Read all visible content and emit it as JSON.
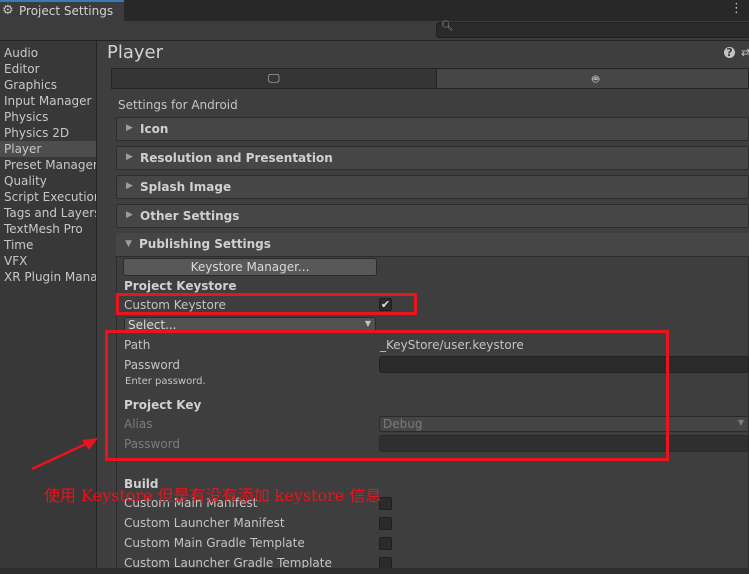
{
  "window": {
    "title": "Project Settings"
  },
  "sidebar": {
    "items": [
      {
        "label": "Audio",
        "selected": false
      },
      {
        "label": "Editor",
        "selected": false
      },
      {
        "label": "Graphics",
        "selected": false
      },
      {
        "label": "Input Manager",
        "selected": false
      },
      {
        "label": "Physics",
        "selected": false
      },
      {
        "label": "Physics 2D",
        "selected": false
      },
      {
        "label": "Player",
        "selected": true
      },
      {
        "label": "Preset Manager",
        "selected": false
      },
      {
        "label": "Quality",
        "selected": false
      },
      {
        "label": "Script Execution",
        "selected": false
      },
      {
        "label": "Tags and Layers",
        "selected": false
      },
      {
        "label": "TextMesh Pro",
        "selected": false
      },
      {
        "label": "Time",
        "selected": false
      },
      {
        "label": "VFX",
        "selected": false
      },
      {
        "label": "XR Plugin Manage",
        "selected": false
      }
    ]
  },
  "main": {
    "title": "Player",
    "platform_tabs": [
      {
        "icon": "desktop-icon",
        "active": false
      },
      {
        "icon": "android-icon",
        "active": true
      }
    ],
    "platform_label": "Settings for Android",
    "sections": [
      "Icon",
      "Resolution and Presentation",
      "Splash Image",
      "Other Settings"
    ],
    "publishing": {
      "title": "Publishing Settings",
      "keystore_manager_button": "Keystore Manager...",
      "project_keystore_header": "Project Keystore",
      "custom_keystore_label": "Custom Keystore",
      "custom_keystore_checked": true,
      "select_dropdown": "Select...",
      "path_label": "Path",
      "path_value": "_KeyStore/user.keystore",
      "password_label": "Password",
      "password_hint": "Enter password.",
      "project_key_header": "Project Key",
      "alias_label": "Alias",
      "alias_value": "Debug",
      "key_password_label": "Password",
      "build_header": "Build",
      "build_items": [
        {
          "label": "Custom Main Manifest",
          "checked": false
        },
        {
          "label": "Custom Launcher Manifest",
          "checked": false
        },
        {
          "label": "Custom Main Gradle Template",
          "checked": false
        },
        {
          "label": "Custom Launcher Gradle Template",
          "checked": false
        }
      ]
    }
  },
  "annotation": {
    "text": "使用 Keystore 但是有没有添加 keystore 信息",
    "color": "#e8141e"
  },
  "colors": {
    "accent": "#3a79bb",
    "panel": "#3e3e3e",
    "sidebar": "#383838"
  }
}
